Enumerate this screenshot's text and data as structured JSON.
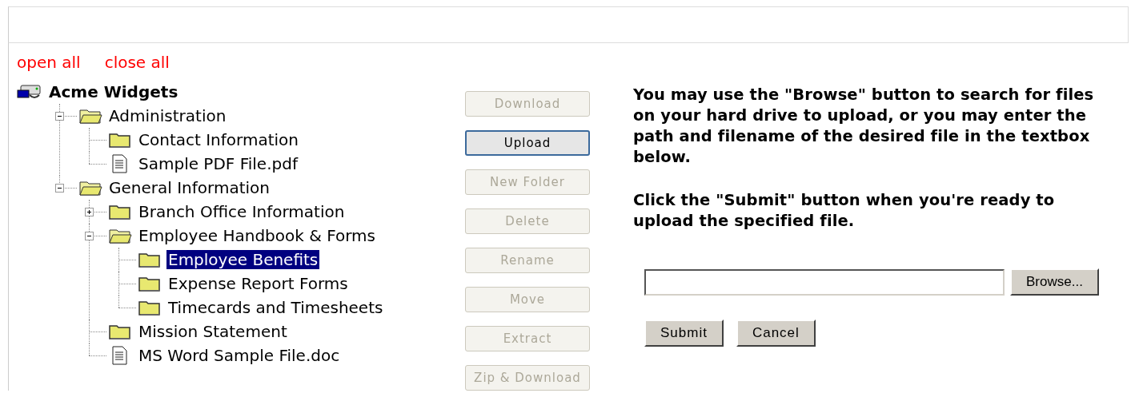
{
  "links": [
    {
      "label": "open all"
    },
    {
      "label": "close all"
    }
  ],
  "tree": {
    "label": "Acme Widgets",
    "kind": "root",
    "selected": false,
    "children": [
      {
        "label": "Administration",
        "kind": "folder",
        "expanded": true,
        "selected": false,
        "children": [
          {
            "label": "Contact Information",
            "kind": "folder",
            "selected": false
          },
          {
            "label": "Sample PDF File.pdf",
            "kind": "file",
            "selected": false
          }
        ]
      },
      {
        "label": "General Information",
        "kind": "folder",
        "expanded": true,
        "selected": false,
        "children": [
          {
            "label": "Branch Office Information",
            "kind": "folder",
            "expanded": false,
            "selected": false
          },
          {
            "label": "Employee Handbook & Forms",
            "kind": "folder",
            "expanded": true,
            "selected": false,
            "children": [
              {
                "label": "Employee Benefits",
                "kind": "folder",
                "selected": true
              },
              {
                "label": "Expense Report Forms",
                "kind": "folder",
                "selected": false
              },
              {
                "label": "Timecards and Timesheets",
                "kind": "folder",
                "selected": false
              }
            ]
          },
          {
            "label": "Mission Statement",
            "kind": "folder",
            "selected": false
          },
          {
            "label": "MS Word Sample File.doc",
            "kind": "file",
            "selected": false
          }
        ]
      }
    ]
  },
  "actions": [
    {
      "label": "Download",
      "disabled": true,
      "focused": false
    },
    {
      "label": "Upload",
      "disabled": false,
      "focused": true
    },
    {
      "label": "New Folder",
      "disabled": true,
      "focused": false
    },
    {
      "label": "Delete",
      "disabled": true,
      "focused": false
    },
    {
      "label": "Rename",
      "disabled": true,
      "focused": false
    },
    {
      "label": "Move",
      "disabled": true,
      "focused": false
    },
    {
      "label": "Extract",
      "disabled": true,
      "focused": false
    },
    {
      "label": "Zip & Download",
      "disabled": true,
      "focused": false
    }
  ],
  "instructions": [
    "You may use the \"Browse\" button to search for files on your hard drive to upload, or you may enter the path and filename of the desired file in the textbox below.",
    "Click the \"Submit\" button when you're ready to upload the specified file."
  ],
  "upload": {
    "browse": "Browse...",
    "buttons": [
      "Submit",
      "Cancel"
    ]
  }
}
